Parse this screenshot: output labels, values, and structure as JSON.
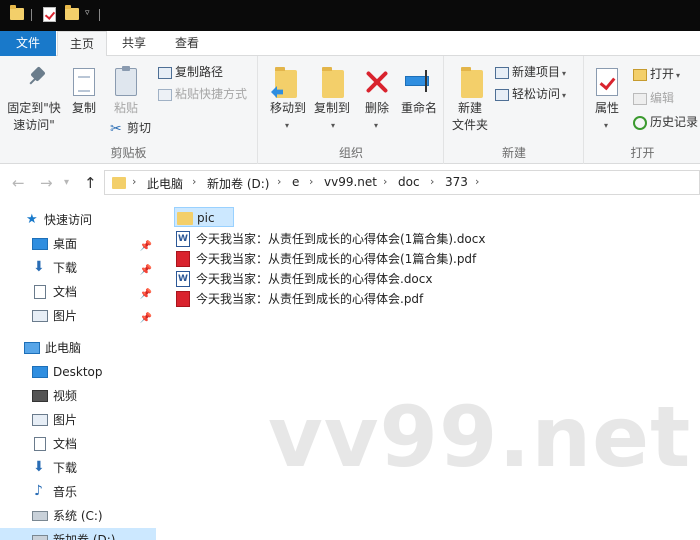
{
  "ribbon_tabs": {
    "file": "文件",
    "home": "主页",
    "share": "共享",
    "view": "查看"
  },
  "clipboard": {
    "pin_label_1": "固定到\"快",
    "pin_label_2": "速访问\"",
    "copy": "复制",
    "paste": "粘贴",
    "copy_path": "复制路径",
    "paste_shortcut": "粘贴快捷方式",
    "cut": "剪切",
    "group": "剪贴板"
  },
  "organize": {
    "move_to": "移动到",
    "copy_to": "复制到",
    "delete": "删除",
    "rename": "重命名",
    "group": "组织"
  },
  "new": {
    "new_folder_1": "新建",
    "new_folder_2": "文件夹",
    "new_item": "新建项目",
    "easy_access": "轻松访问",
    "group": "新建"
  },
  "open": {
    "properties": "属性",
    "open": "打开",
    "edit": "编辑",
    "history": "历史记录",
    "group": "打开"
  },
  "breadcrumb": [
    "此电脑",
    "新加卷 (D:)",
    "e",
    "vv99.net",
    "doc",
    "373"
  ],
  "nav_pane": {
    "quick_access": "快速访问",
    "desktop": "桌面",
    "downloads": "下载",
    "documents": "文档",
    "pictures": "图片",
    "this_pc": "此电脑",
    "pc_desktop": "Desktop",
    "videos": "视频",
    "pc_pictures": "图片",
    "pc_documents": "文档",
    "pc_downloads": "下载",
    "music": "音乐",
    "system_drive": "系统 (C:)",
    "new_volume": "新加卷 (D:)"
  },
  "files": [
    {
      "name": "pic",
      "type": "folder"
    },
    {
      "name": "今天我当家：从责任到成长的心得体会(1篇合集).docx",
      "type": "docx"
    },
    {
      "name": "今天我当家：从责任到成长的心得体会(1篇合集).pdf",
      "type": "pdf"
    },
    {
      "name": "今天我当家：从责任到成长的心得体会.docx",
      "type": "docx"
    },
    {
      "name": "今天我当家：从责任到成长的心得体会.pdf",
      "type": "pdf"
    }
  ],
  "watermark": "vv99.net",
  "colors": {
    "file_tab": "#1979ca",
    "selection": "#cce8ff",
    "ribbon_bg": "#f5f6f7",
    "titlebar": "#0a0a0a"
  }
}
